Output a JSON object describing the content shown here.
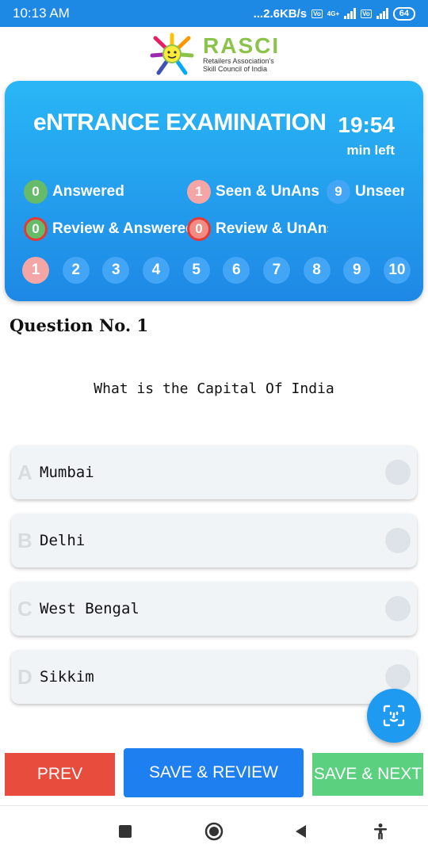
{
  "status_bar": {
    "time": "10:13 AM",
    "net_speed": "...2.6KB/s",
    "network_label": "4G+",
    "volte": "Vo LTE",
    "battery": "64"
  },
  "logo": {
    "name": "RASCI",
    "line1": "Retailers Association's",
    "line2": "Skill Council of India"
  },
  "header": {
    "title": "eNTRANCE EXAMINATION",
    "timer": "19:54",
    "timer_label": "min left"
  },
  "stats": {
    "answered": {
      "count": "0",
      "label": "Answered"
    },
    "seen_unans": {
      "count": "1",
      "label": "Seen & UnAns"
    },
    "unseen": {
      "count": "9",
      "label": "Unseen"
    },
    "review_answered": {
      "count": "0",
      "label": "Review & Answered"
    },
    "review_unans": {
      "count": "0",
      "label": "Review & UnAns"
    }
  },
  "question_numbers": [
    "1",
    "2",
    "3",
    "4",
    "5",
    "6",
    "7",
    "8",
    "9",
    "10"
  ],
  "active_question": "1",
  "question": {
    "number_label": "Question No. 1",
    "text": "What is the Capital Of India"
  },
  "options": [
    {
      "letter": "A",
      "label": "Mumbai"
    },
    {
      "letter": "B",
      "label": "Delhi"
    },
    {
      "letter": "C",
      "label": "West Bengal"
    },
    {
      "letter": "D",
      "label": "Sikkim"
    }
  ],
  "buttons": {
    "prev": "PREV",
    "save_review": "SAVE & REVIEW",
    "save_next": "SAVE & NEXT"
  },
  "colors": {
    "card_top": "#29b6f6",
    "card_bottom": "#1e88e5",
    "prev": "#e74c3c",
    "review": "#1e7ff0",
    "next": "#5bd07f"
  },
  "icons": {
    "fab": "face-scan-icon",
    "nav": [
      "recents-square-icon",
      "home-circle-icon",
      "back-triangle-icon",
      "accessibility-icon"
    ]
  }
}
